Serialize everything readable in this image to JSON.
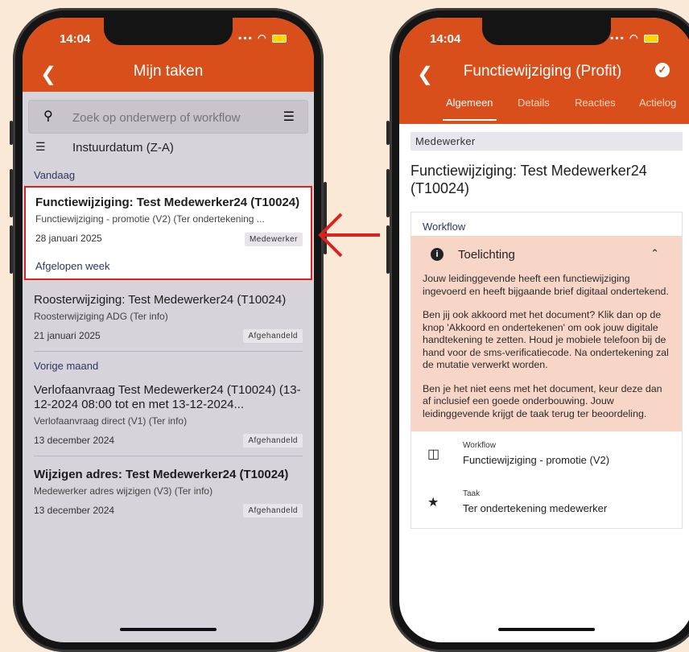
{
  "left_phone": {
    "status_time": "14:04",
    "header": {
      "title": "Mijn taken"
    },
    "search": {
      "placeholder": "Zoek op onderwerp of workflow"
    },
    "sort": {
      "label": "Instuurdatum (Z-A)"
    },
    "sections": {
      "today": "Vandaag",
      "past_week": "Afgelopen week",
      "previous_month": "Vorige maand"
    },
    "tasks": [
      {
        "title": "Functiewijziging: Test Medewerker24 (T10024)",
        "subtitle": "Functiewijziging - promotie (V2) (Ter ondertekening ...",
        "date": "28 januari 2025",
        "badge": "Medewerker"
      },
      {
        "title": "Roosterwijziging: Test Medewerker24 (T10024)",
        "subtitle": "Roosterwijziging ADG (Ter info)",
        "date": "21 januari 2025",
        "badge": "Afgehandeld"
      },
      {
        "title": "Verlofaanvraag Test Medewerker24 (T10024) (13-12-2024 08:00 tot en met 13-12-2024...",
        "subtitle": "Verlofaanvraag direct (V1) (Ter info)",
        "date": "13 december 2024",
        "badge": "Afgehandeld"
      },
      {
        "title": "Wijzigen adres: Test Medewerker24 (T10024)",
        "subtitle": "Medewerker adres wijzigen (V3) (Ter info)",
        "date": "13 december 2024",
        "badge": "Afgehandeld"
      }
    ]
  },
  "right_phone": {
    "status_time": "14:04",
    "header": {
      "title": "Functiewijziging (Profit)"
    },
    "tabs": [
      "Algemeen",
      "Details",
      "Reacties",
      "Actielog"
    ],
    "employee_label": "Medewerker",
    "title": "Functiewijziging: Test Medewerker24 (T10024)",
    "workflow_heading": "Workflow",
    "toelichting": {
      "label": "Toelichting",
      "paragraphs": [
        "Jouw leidinggevende heeft een functiewijziging ingevoerd en heeft bijgaande brief digitaal ondertekend.",
        "Ben jij ook akkoord met het document? Klik dan op de knop 'Akkoord en ondertekenen' om ook jouw digitale handtekening te zetten. Houd je mobiele telefoon bij de hand voor de sms-verificatiecode. Na ondertekening zal de mutatie verwerkt worden.",
        "Ben je het niet eens met het document, keur deze dan af inclusief een goede onderbouwing. Jouw leidinggevende krijgt de taak terug ter beoordeling."
      ]
    },
    "meta": [
      {
        "label": "Workflow",
        "value": "Functiewijziging - promotie (V2)",
        "icon": "workflow-icon"
      },
      {
        "label": "Taak",
        "value": "Ter ondertekening medewerker",
        "icon": "star-icon"
      }
    ]
  },
  "colors": {
    "background": "#fbe9d8",
    "brand": "#d94f1c",
    "highlight": "#d9241d",
    "callout": "#f7d6c8"
  }
}
